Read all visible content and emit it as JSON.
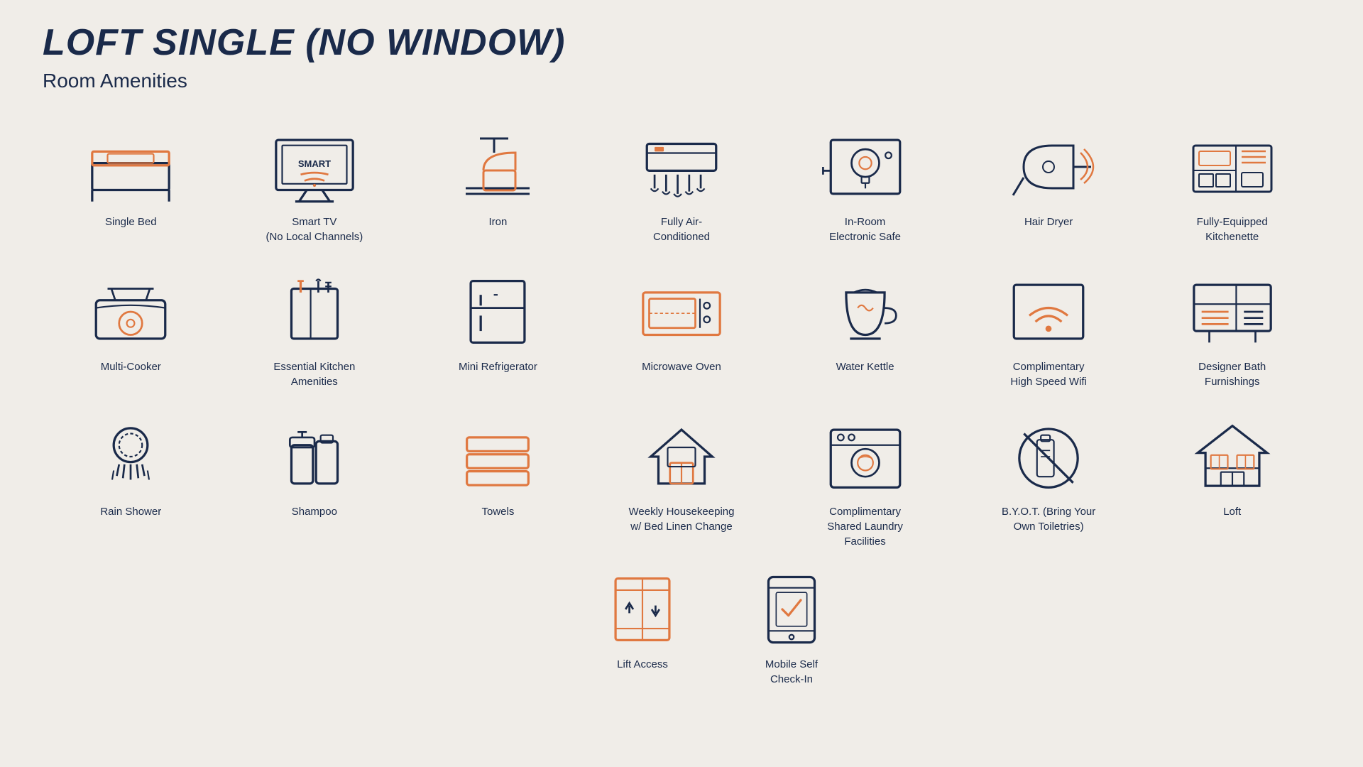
{
  "page": {
    "title": "LOFT SINGLE (NO WINDOW)",
    "subtitle": "Room Amenities"
  },
  "amenities": [
    {
      "id": "single-bed",
      "label": "Single Bed"
    },
    {
      "id": "smart-tv",
      "label": "Smart TV\n(No Local Channels)"
    },
    {
      "id": "iron",
      "label": "Iron"
    },
    {
      "id": "air-conditioned",
      "label": "Fully Air-\nConditioned"
    },
    {
      "id": "electronic-safe",
      "label": "In-Room\nElectronic Safe"
    },
    {
      "id": "hair-dryer",
      "label": "Hair Dryer"
    },
    {
      "id": "kitchenette",
      "label": "Fully-Equipped\nKitchenette"
    },
    {
      "id": "multi-cooker",
      "label": "Multi-Cooker"
    },
    {
      "id": "kitchen-amenities",
      "label": "Essential Kitchen\nAmenities"
    },
    {
      "id": "mini-refrigerator",
      "label": "Mini Refrigerator"
    },
    {
      "id": "microwave-oven",
      "label": "Microwave Oven"
    },
    {
      "id": "water-kettle",
      "label": "Water Kettle"
    },
    {
      "id": "wifi",
      "label": "Complimentary\nHigh Speed Wifi"
    },
    {
      "id": "bath-furnishings",
      "label": "Designer Bath\nFurnishings"
    },
    {
      "id": "rain-shower",
      "label": "Rain Shower"
    },
    {
      "id": "shampoo",
      "label": "Shampoo"
    },
    {
      "id": "towels",
      "label": "Towels"
    },
    {
      "id": "housekeeping",
      "label": "Weekly Housekeeping\nw/ Bed Linen Change"
    },
    {
      "id": "laundry",
      "label": "Complimentary\nShared Laundry\nFacilities"
    },
    {
      "id": "byot",
      "label": "B.Y.O.T. (Bring Your\nOwn Toiletries)"
    },
    {
      "id": "loft",
      "label": "Loft"
    }
  ],
  "bottom_amenities": [
    {
      "id": "lift-access",
      "label": "Lift Access"
    },
    {
      "id": "mobile-checkin",
      "label": "Mobile Self\nCheck-In"
    }
  ],
  "colors": {
    "navy": "#1a2a4a",
    "orange": "#e07840",
    "bg": "#f0ede8"
  }
}
